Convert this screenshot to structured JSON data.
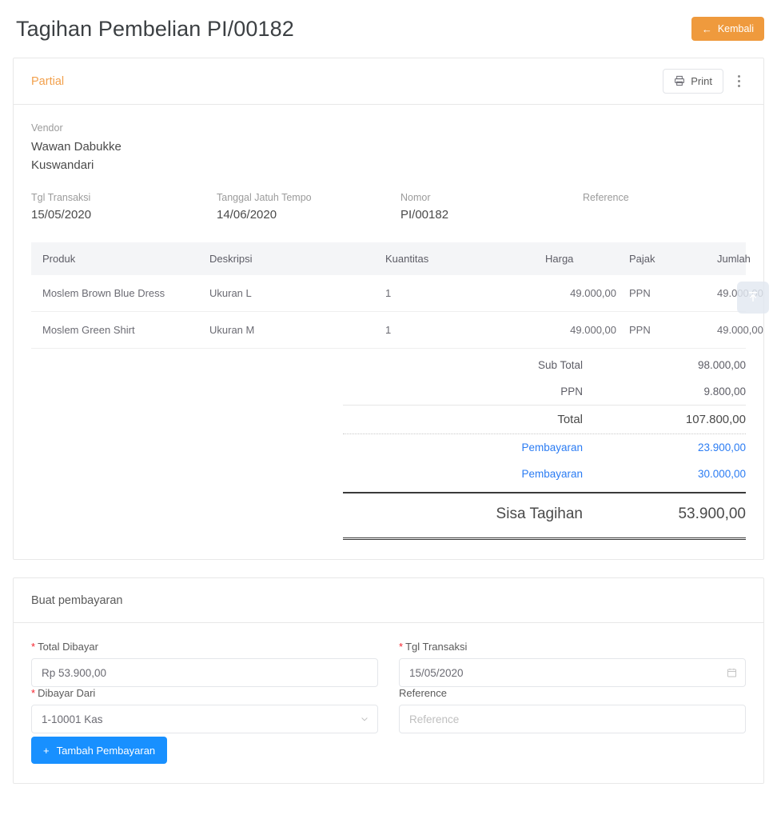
{
  "header": {
    "title": "Tagihan Pembelian PI/00182",
    "back_label": "Kembali",
    "back_color": "#ef9a3d"
  },
  "invoice_card": {
    "status": "Partial",
    "status_color": "#f2a04c",
    "print_label": "Print",
    "vendor_label": "Vendor",
    "vendor_name_line1": "Wawan Dabukke",
    "vendor_name_line2": "Kuswandari",
    "meta": [
      {
        "label": "Tgl Transaksi",
        "value": "15/05/2020"
      },
      {
        "label": "Tanggal Jatuh Tempo",
        "value": "14/06/2020"
      },
      {
        "label": "Nomor",
        "value": "PI/00182"
      },
      {
        "label": "Reference",
        "value": ""
      }
    ],
    "table": {
      "columns": [
        "Produk",
        "Deskripsi",
        "Kuantitas",
        "Harga",
        "Pajak",
        "Jumlah"
      ],
      "rows": [
        {
          "produk": "Moslem Brown Blue Dress",
          "deskripsi": "Ukuran L",
          "kuantitas": "1",
          "harga": "49.000,00",
          "pajak": "PPN",
          "jumlah": "49.000,00"
        },
        {
          "produk": "Moslem Green Shirt",
          "deskripsi": "Ukuran M",
          "kuantitas": "1",
          "harga": "49.000,00",
          "pajak": "PPN",
          "jumlah": "49.000,00"
        }
      ]
    },
    "totals": {
      "subtotal_label": "Sub Total",
      "subtotal_value": "98.000,00",
      "ppn_label": "PPN",
      "ppn_value": "9.800,00",
      "total_label": "Total",
      "total_value": "107.800,00",
      "payments": [
        {
          "label": "Pembayaran",
          "value": "23.900,00"
        },
        {
          "label": "Pembayaran",
          "value": "30.000,00"
        }
      ],
      "payment_color": "#2b7cf3",
      "remaining_label": "Sisa Tagihan",
      "remaining_value": "53.900,00"
    }
  },
  "payment_form": {
    "title": "Buat pembayaran",
    "total_dibayar_label": "Total Dibayar",
    "total_dibayar_value": "Rp 53.900,00",
    "tgl_transaksi_label": "Tgl Transaksi",
    "tgl_transaksi_value": "15/05/2020",
    "dibayar_dari_label": "Dibayar Dari",
    "dibayar_dari_value": "1-10001 Kas",
    "reference_label": "Reference",
    "reference_value": "",
    "reference_placeholder": "Reference",
    "submit_label": "Tambah Pembayaran",
    "submit_color": "#1890ff",
    "required_marker": "*"
  }
}
